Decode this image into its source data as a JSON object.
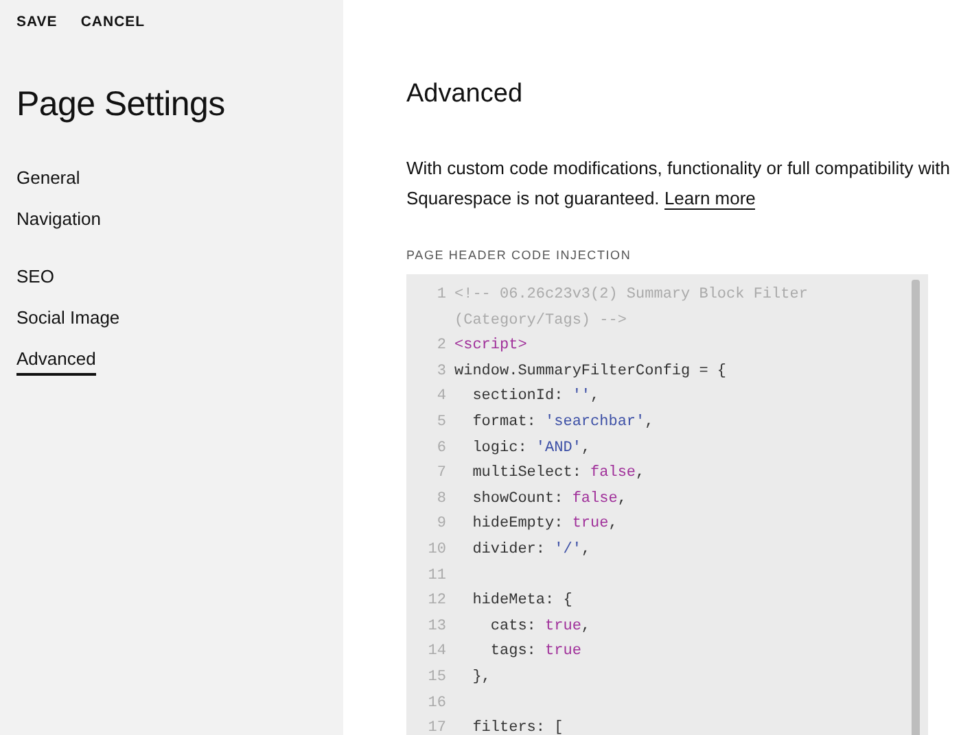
{
  "actions": [
    "SAVE",
    "CANCEL"
  ],
  "sidebar": {
    "title": "Page Settings",
    "groups": [
      [
        {
          "label": "General",
          "selected": false
        },
        {
          "label": "Navigation",
          "selected": false
        }
      ],
      [
        {
          "label": "SEO",
          "selected": false
        },
        {
          "label": "Social Image",
          "selected": false
        },
        {
          "label": "Advanced",
          "selected": true
        }
      ]
    ]
  },
  "main": {
    "title": "Advanced",
    "description": "With custom code modifications, functionality or full compatibility with Squarespace is not guaranteed.",
    "link": "Learn more",
    "field_label": "PAGE HEADER CODE INJECTION",
    "code_lines": [
      {
        "number": "1",
        "tokens": [
          {
            "kind": "comment",
            "text": "<!-- 06.26c23v3(2) Summary Block Filter"
          }
        ]
      },
      {
        "tokens": [
          {
            "kind": "comment",
            "text": "(Category/Tags) -->"
          }
        ]
      },
      {
        "number": "2",
        "tokens": [
          {
            "kind": "tag",
            "text": "<script>"
          }
        ]
      },
      {
        "number": "3",
        "tokens": [
          {
            "kind": "plain",
            "text": "window.SummaryFilterConfig = {"
          }
        ]
      },
      {
        "number": "4",
        "tokens": [
          {
            "kind": "plain",
            "text": "  sectionId: "
          },
          {
            "kind": "string",
            "text": "''"
          },
          {
            "kind": "plain",
            "text": ","
          }
        ]
      },
      {
        "number": "5",
        "tokens": [
          {
            "kind": "plain",
            "text": "  format: "
          },
          {
            "kind": "string",
            "text": "'searchbar'"
          },
          {
            "kind": "plain",
            "text": ","
          }
        ]
      },
      {
        "number": "6",
        "tokens": [
          {
            "kind": "plain",
            "text": "  logic: "
          },
          {
            "kind": "string",
            "text": "'AND'"
          },
          {
            "kind": "plain",
            "text": ","
          }
        ]
      },
      {
        "number": "7",
        "tokens": [
          {
            "kind": "plain",
            "text": "  multiSelect: "
          },
          {
            "kind": "keyword",
            "text": "false"
          },
          {
            "kind": "plain",
            "text": ","
          }
        ]
      },
      {
        "number": "8",
        "tokens": [
          {
            "kind": "plain",
            "text": "  showCount: "
          },
          {
            "kind": "keyword",
            "text": "false"
          },
          {
            "kind": "plain",
            "text": ","
          }
        ]
      },
      {
        "number": "9",
        "tokens": [
          {
            "kind": "plain",
            "text": "  hideEmpty: "
          },
          {
            "kind": "keyword",
            "text": "true"
          },
          {
            "kind": "plain",
            "text": ","
          }
        ]
      },
      {
        "number": "10",
        "tokens": [
          {
            "kind": "plain",
            "text": "  divider: "
          },
          {
            "kind": "string",
            "text": "'/'"
          },
          {
            "kind": "plain",
            "text": ","
          }
        ]
      },
      {
        "number": "11"
      },
      {
        "number": "12",
        "tokens": [
          {
            "kind": "plain",
            "text": "  hideMeta: {"
          }
        ]
      },
      {
        "number": "13",
        "tokens": [
          {
            "kind": "plain",
            "text": "    cats: "
          },
          {
            "kind": "keyword",
            "text": "true"
          },
          {
            "kind": "plain",
            "text": ","
          }
        ]
      },
      {
        "number": "14",
        "tokens": [
          {
            "kind": "plain",
            "text": "    tags: "
          },
          {
            "kind": "keyword",
            "text": "true"
          }
        ]
      },
      {
        "number": "15",
        "tokens": [
          {
            "kind": "plain",
            "text": "  },"
          }
        ]
      },
      {
        "number": "16"
      },
      {
        "number": "17",
        "tokens": [
          {
            "kind": "plain",
            "text": "  filters: ["
          }
        ]
      }
    ]
  }
}
